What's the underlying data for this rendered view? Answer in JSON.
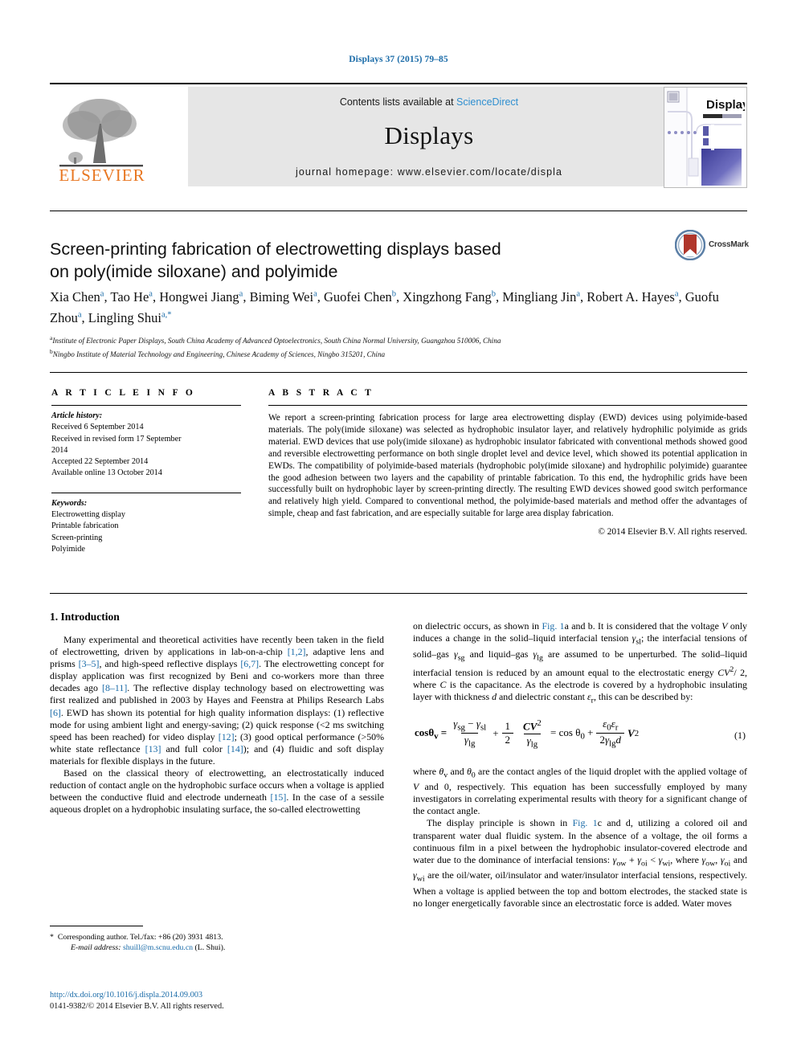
{
  "running_head": "Displays 37 (2015) 79–85",
  "masthead": {
    "contents_prefix": "Contents lists available at ",
    "sciencedirect": "ScienceDirect",
    "journal_title": "Displays",
    "homepage": "journal homepage: www.elsevier.com/locate/displa",
    "publisher_logo_text": "ELSEVIER",
    "cover_title": "Displays"
  },
  "crossmark": {
    "label": "CrossMark"
  },
  "article": {
    "title_line1": "Screen-printing fabrication of electrowetting displays based",
    "title_line2": "on poly(imide siloxane) and polyimide",
    "authors": [
      {
        "name": "Xia Chen",
        "sup": "a",
        "sep": ", "
      },
      {
        "name": "Tao He",
        "sup": "a",
        "sep": ", "
      },
      {
        "name": "Hongwei Jiang",
        "sup": "a",
        "sep": ", "
      },
      {
        "name": "Biming Wei",
        "sup": "a",
        "sep": ", "
      },
      {
        "name": "Guofei Chen",
        "sup": "b",
        "sep": ", "
      },
      {
        "name": "Xingzhong Fang",
        "sup": "b",
        "sep": ", "
      },
      {
        "name": "Mingliang Jin",
        "sup": "a",
        "sep": ", "
      },
      {
        "name": "Robert A. Hayes",
        "sup": "a",
        "sep": ", "
      },
      {
        "name": "Guofu Zhou",
        "sup": "a",
        "sep": ", "
      },
      {
        "name": "Lingling Shui",
        "sup": "a,*",
        "sep": ""
      }
    ],
    "affiliations": [
      {
        "mark": "a",
        "text": "Institute of Electronic Paper Displays, South China Academy of Advanced Optoelectronics, South China Normal University, Guangzhou 510006, China"
      },
      {
        "mark": "b",
        "text": "Ningbo Institute of Material Technology and Engineering, Chinese Academy of Sciences, Ningbo 315201, China"
      }
    ]
  },
  "article_info": {
    "heading": "A R T I C L E    I N F O",
    "history_label": "Article history:",
    "history": [
      "Received 6 September 2014",
      "Received in revised form 17 September",
      "2014",
      "Accepted 22 September 2014",
      "Available online 13 October 2014"
    ],
    "keywords_label": "Keywords:",
    "keywords": [
      "Electrowetting display",
      "Printable fabrication",
      "Screen-printing",
      "Polyimide"
    ]
  },
  "abstract": {
    "heading": "A B S T R A C T",
    "text": "We report a screen-printing fabrication process for large area electrowetting display (EWD) devices using polyimide-based materials. The poly(imide siloxane) was selected as hydrophobic insulator layer, and relatively hydrophilic polyimide as grids material. EWD devices that use poly(imide siloxane) as hydrophobic insulator fabricated with conventional methods showed good and reversible electrowetting performance on both single droplet level and device level, which showed its potential application in EWDs. The compatibility of polyimide-based materials (hydrophobic poly(imide siloxane) and hydrophilic polyimide) guarantee the good adhesion between two layers and the capability of printable fabrication. To this end, the hydrophilic grids have been successfully built on hydrophobic layer by screen-printing directly. The resulting EWD devices showed good switch performance and relatively high yield. Compared to conventional method, the polyimide-based materials and method offer the advantages of simple, cheap and fast fabrication, and are especially suitable for large area display fabrication.",
    "copyright": "© 2014 Elsevier B.V. All rights reserved."
  },
  "body": {
    "section1_heading": "1. Introduction",
    "left_p1_parts": {
      "a": "Many experimental and theoretical activities have recently been taken in the field of electrowetting, driven by applications in lab-on-a-chip ",
      "r1": "[1,2]",
      "b": ", adaptive lens and prisms ",
      "r2": "[3–5]",
      "c": ", and high-speed reflective displays ",
      "r3": "[6,7]",
      "d": ". The electrowetting concept for display application was first recognized by Beni and co-workers more than three decades ago ",
      "r4": "[8–11]",
      "e": ". The reflective display technology based on electrowetting was first realized and published in 2003 by Hayes and Feenstra at Philips Research Labs ",
      "r5": "[6]",
      "f": ". EWD has shown its potential for high quality information displays: (1) reflective mode for using ambient light and energy-saving; (2) quick response (<2 ms switching speed has been reached) for video display ",
      "r6": "[12]",
      "g": "; (3) good optical performance (>50% white state reflectance ",
      "r7": "[13]",
      "h": " and full color ",
      "r8": "[14]",
      "i": "); and (4) fluidic and soft display materials for flexible displays in the future."
    },
    "left_p2_parts": {
      "a": "Based on the classical theory of electrowetting, an electrostatically induced reduction of contact angle on the hydrophobic surface occurs when a voltage is applied between the conductive fluid and electrode underneath ",
      "r1": "[15]",
      "b": ". In the case of a sessile aqueous droplet on a hydrophobic insulating surface, the so-called electrowetting"
    },
    "right_p1_parts": {
      "a": "on dielectric occurs, as shown in ",
      "fig": "Fig. 1",
      "b": "a and b. It is considered that the voltage V only induces a change in the solid–liquid interfacial tension γsl; the interfacial tensions of solid–gas γsg and liquid–gas γlg are assumed to be unperturbed. The solid–liquid interfacial tension is reduced by an amount equal to the electrostatic energy CV²/2, where C is the capacitance. As the electrode is covered by a hydrophobic insulating layer with thickness d and dielectric constant εr, this can be described by:"
    },
    "equation_number": "(1)",
    "equation_text": "cosθv = (γsg − γsl)/γlg + (1/2)(CV²/γlg) = cos θ0 + (ε0εr/(2γlg d))V²",
    "right_p2": "where θv and θ0 are the contact angles of the liquid droplet with the applied voltage of V and 0, respectively. This equation has been successfully employed by many investigators in correlating experimental results with theory for a significant change of the contact angle.",
    "right_p3_parts": {
      "a": "The display principle is shown in ",
      "fig": "Fig. 1",
      "b": "c and d, utilizing a colored oil and transparent water dual fluidic system. In the absence of a voltage, the oil forms a continuous film in a pixel between the hydrophobic insulator-covered electrode and water due to the dominance of interfacial tensions: γow + γoi < γwi, where γow, γoi and γwi are the oil/water, oil/insulator and water/insulator interfacial tensions, respectively. When a voltage is applied between the top and bottom electrodes, the stacked state is no longer energetically favorable since an electrostatic force is added. Water moves"
    }
  },
  "footnote": {
    "star": "*",
    "corresponding": "Corresponding author. Tel./fax: +86 (20) 3931 4813.",
    "email_label": "E-mail address:",
    "email": "shuill@m.scnu.edu.cn",
    "email_owner": "(L. Shui)."
  },
  "footer": {
    "doi": "http://dx.doi.org/10.1016/j.displa.2014.09.003",
    "copyright": "0141-9382/© 2014 Elsevier B.V. All rights reserved."
  },
  "colors": {
    "link": "#1a6ba8",
    "sciencedirect": "#2f8fd0",
    "elsevier_orange": "#e87722",
    "band_gray": "#e6e6e6"
  }
}
